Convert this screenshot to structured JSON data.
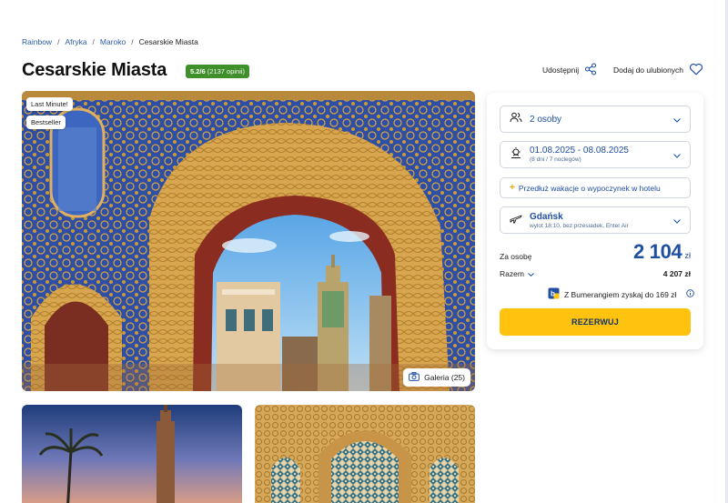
{
  "breadcrumb": {
    "items": [
      "Rainbow",
      "Afryka",
      "Maroko"
    ],
    "current": "Cesarskie Miasta",
    "separator": "/"
  },
  "header": {
    "title": "Cesarskie Miasta",
    "rating_score": "5.2/6",
    "rating_count": "(2137 opinii)",
    "share_label": "Udostępnij",
    "favorite_label": "Dodaj do ulubionych"
  },
  "gallery": {
    "badges": [
      "Last Minute!",
      "Bestseller"
    ],
    "gallery_button": "Galeria (25)",
    "icon": "camera-icon"
  },
  "booking": {
    "persons": "2 osoby",
    "dates_main": "01.08.2025 - 08.08.2025",
    "dates_sub": "(8 dni / 7 noclegów)",
    "extend_label": "Przedłuż wakacje o wypoczynek w hotelu",
    "flight_city": "Gdańsk",
    "flight_details": "wylot 18:10, bez przesiadek, Enter Air",
    "price_label": "Za osobę",
    "price_amount": "2 104",
    "price_currency": "zł",
    "total_label": "Razem",
    "total_value": "4 207 zł",
    "boomerang_text": "Z Bumerangiem zyskaj do 169 zł",
    "reserve_label": "REZERWUJ"
  },
  "colors": {
    "brand_blue": "#1f4fa0",
    "rating_green": "#3f8f2b",
    "cta_yellow": "#ffc20e"
  }
}
